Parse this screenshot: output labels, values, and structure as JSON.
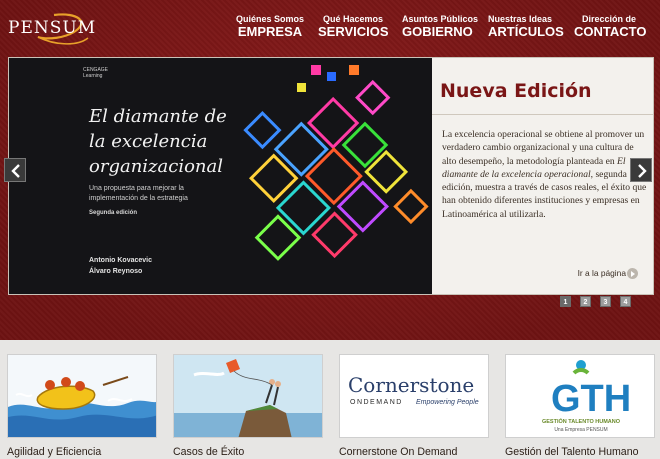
{
  "brand": {
    "logo_text": "PENSUM"
  },
  "nav": [
    {
      "small": "Quiénes Somos",
      "big": "EMPRESA"
    },
    {
      "small": "Qué Hacemos",
      "big": "SERVICIOS"
    },
    {
      "small": "Asuntos Públicos",
      "big": "GOBIERNO"
    },
    {
      "small": "Nuestras Ideas",
      "big": "ARTÍCULOS"
    },
    {
      "small": "Dirección de",
      "big": "CONTACTO"
    }
  ],
  "slide": {
    "cover": {
      "publisher_line1": "CENGAGE",
      "publisher_line2": "Learning",
      "title": "El diamante de la excelencia organizacional",
      "subtitle": "Una propuesta para mejorar la implementación de la estrategia",
      "edition": "Segunda edición",
      "author1": "Antonio Kovacevic",
      "author2": "Álvaro Reynoso"
    },
    "heading": "Nueva Edición",
    "body_part1": "La excelencia operacional se obtiene al promover un verdadero cambio organizacional y una cultura de alto desempeño, la metodología planteada en ",
    "body_italic": "El diamante de la excelencia operacional",
    "body_part2": ", segunda edición, muestra a través de casos reales, el éxito que han obtenido diferentes instituciones y empresas en Latinoamérica al utilizarla.",
    "more_link": "Ir a la página",
    "pager": [
      "1",
      "2",
      "3",
      "4"
    ],
    "active_page": "1"
  },
  "cards": [
    {
      "label": "Agilidad y Eficiencia",
      "image": "rafting-illustration"
    },
    {
      "label": "Casos de Éxito",
      "image": "kite-cliff-illustration"
    },
    {
      "label": "Cornerstone On Demand",
      "logo_main": "Cornerstone",
      "logo_left": "ONDEMAND",
      "logo_right": "Empowering People"
    },
    {
      "label": "Gestión del Talento Humano",
      "logo_letters": "GTH",
      "logo_caption": "GESTIÓN TALENTO HUMANO",
      "logo_sub": "Una Empresa PENSUM"
    }
  ],
  "colors": {
    "brand_red": "#7a1616",
    "slide_heading": "#7a1616"
  }
}
